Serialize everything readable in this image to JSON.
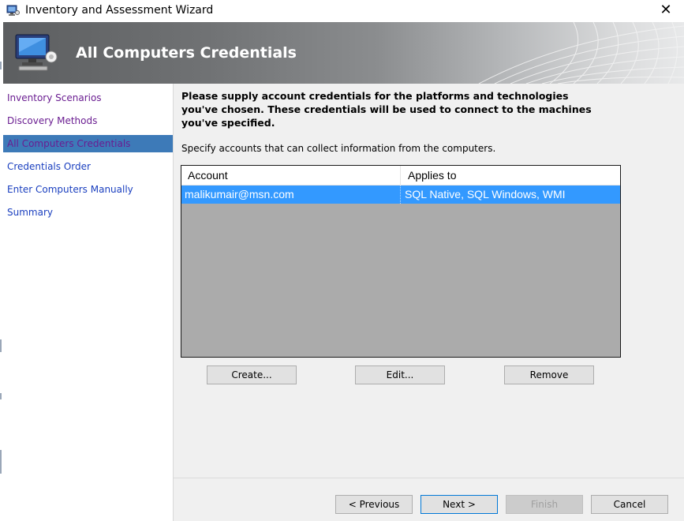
{
  "window": {
    "title": "Inventory and Assessment Wizard",
    "close_glyph": "✕"
  },
  "banner": {
    "title": "All Computers Credentials"
  },
  "nav": {
    "items": [
      {
        "label": "Inventory Scenarios"
      },
      {
        "label": "Discovery Methods"
      },
      {
        "label": "All Computers Credentials"
      },
      {
        "label": "Credentials Order"
      },
      {
        "label": "Enter Computers Manually"
      },
      {
        "label": "Summary"
      }
    ]
  },
  "content": {
    "heading": "Please supply account credentials for the platforms and technologies you've chosen. These credentials will be used to connect to the machines you've specified.",
    "subtext": "Specify accounts that can collect information from the computers.",
    "table": {
      "columns": [
        "Account",
        "Applies to"
      ],
      "rows": [
        {
          "account": "malikumair@msn.com",
          "applies_to": "SQL Native, SQL Windows, WMI"
        }
      ]
    },
    "buttons": {
      "create": "Create...",
      "edit": "Edit...",
      "remove": "Remove"
    }
  },
  "footer": {
    "previous": "< Previous",
    "next": "Next >",
    "finish": "Finish",
    "cancel": "Cancel"
  },
  "colors": {
    "nav_link": "#1a3fbf",
    "nav_visited": "#6a1d91",
    "nav_active_bg": "#3d7ab8",
    "selection": "#3399ff",
    "list_bg": "#ababab"
  },
  "icons": {
    "app": "wizard-computer-icon",
    "banner": "monitor-computer-icon",
    "close": "close-icon"
  }
}
